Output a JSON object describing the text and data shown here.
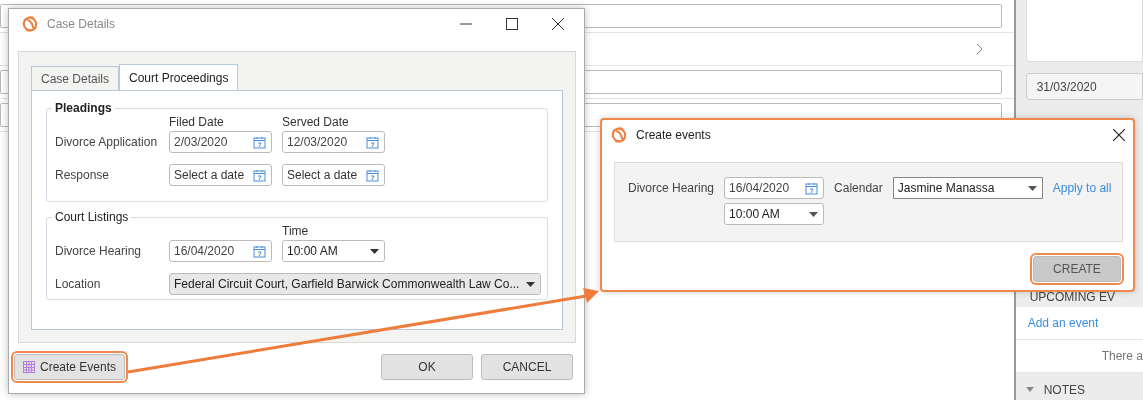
{
  "sidebar": {
    "date": "31/03/2020",
    "upcoming_header": "UPCOMING EV",
    "add_event_link": "Add an event",
    "empty_note": "There a",
    "notes_header": "NOTES"
  },
  "case_dialog": {
    "title": "Case Details",
    "tabs": [
      {
        "label": "Case Details",
        "selected": false
      },
      {
        "label": "Court Proceedings",
        "selected": true
      }
    ],
    "pleadings": {
      "title": "Pleadings",
      "columns": [
        "Filed Date",
        "Served Date"
      ],
      "rows": [
        {
          "label": "Divorce Application",
          "fields": [
            {
              "value": "2/03/2020"
            },
            {
              "value": "12/03/2020"
            }
          ]
        },
        {
          "label": "Response",
          "fields": [
            {
              "placeholder": "Select a date"
            },
            {
              "placeholder": "Select a date"
            }
          ]
        }
      ]
    },
    "court_listings": {
      "title": "Court Listings",
      "time_label": "Time",
      "hearing": {
        "label": "Divorce Hearing",
        "date": "16/04/2020",
        "time": "10:00 AM"
      },
      "location": {
        "label": "Location",
        "value": "Federal Circuit Court, Garfield Barwick Commonwealth Law Co..."
      }
    },
    "create_events_button": {
      "label": "Create Events",
      "highlighted": true
    },
    "buttons": [
      "OK",
      "CANCEL"
    ]
  },
  "create_dialog": {
    "title": "Create events",
    "event": {
      "label": "Divorce Hearing",
      "date": "16/04/2020",
      "time": "10:00 AM"
    },
    "calendar_label": "Calendar",
    "calendar": "Jasmine Manassa",
    "apply_link": "Apply to all",
    "create_button": {
      "label": "CREATE",
      "highlighted": true
    }
  }
}
